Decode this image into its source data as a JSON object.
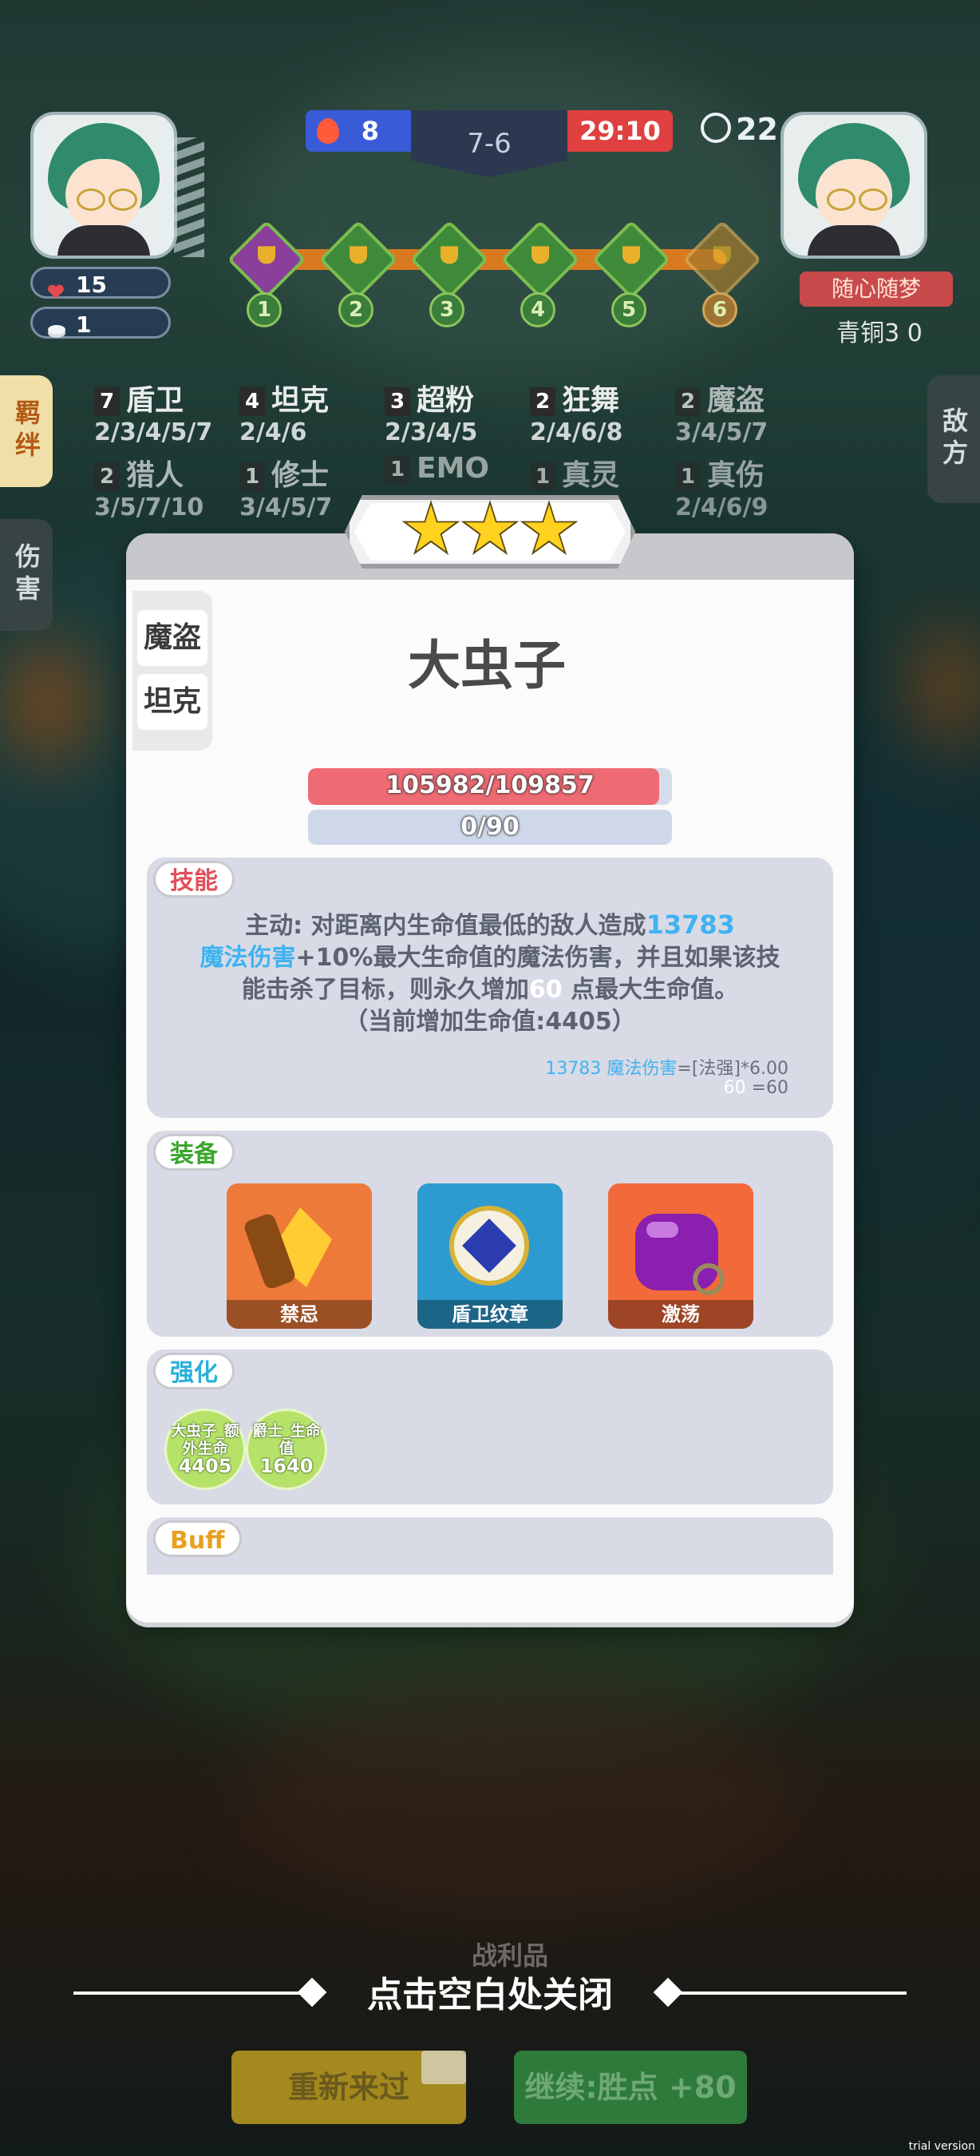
{
  "hud": {
    "hearts": "15",
    "coins": "1",
    "score_blue": "8",
    "round": "7-6",
    "score_red": "29:10",
    "timer": "22.5",
    "progress_nodes": [
      "1",
      "2",
      "3",
      "4",
      "5",
      "6"
    ],
    "opponent_badge": "随心随梦",
    "opponent_rank": "青铜3 0"
  },
  "side_tabs": {
    "left_active": "羁绊",
    "left_idle": "伤害",
    "right": "敌方"
  },
  "traits": [
    {
      "count": "7",
      "name": "盾卫",
      "levels": "2/3/4/5/7"
    },
    {
      "count": "4",
      "name": "坦克",
      "levels": "2/4/6"
    },
    {
      "count": "3",
      "name": "超粉",
      "levels": "2/3/4/5"
    },
    {
      "count": "2",
      "name": "狂舞",
      "levels": "2/4/6/8"
    },
    {
      "count": "2",
      "name": "魔盗",
      "levels": "3/4/5/7"
    },
    {
      "count": "2",
      "name": "猎人",
      "levels": "3/5/7/10"
    },
    {
      "count": "1",
      "name": "修士",
      "levels": "3/4/5/7"
    },
    {
      "count": "1",
      "name": "EMO",
      "levels": ""
    },
    {
      "count": "1",
      "name": "真灵",
      "levels": ""
    },
    {
      "count": "1",
      "name": "真伤",
      "levels": "2/4/6/9"
    }
  ],
  "modal": {
    "stars": 3,
    "tags": [
      "魔盗",
      "坦克"
    ],
    "hero_name": "大虫子",
    "hp_text": "105982/109857",
    "hp_fraction": 0.9647,
    "mp_text": "0/90",
    "skill": {
      "label": "技能",
      "line1_a": "主动: 对距离内生命值最低的敌人造成",
      "line1_b": "13783",
      "line2_a": "魔法伤害",
      "line2_b": "+10%最大生命值的魔法伤害，并且如果该技",
      "line3_a": "能击杀了目标，则永久增加",
      "line3_b": "60",
      "line3_c": "点最大生命值。",
      "line4": "（当前增加生命值:4405）",
      "formula1_a": "13783 魔法伤害",
      "formula1_b": "=[法强]*6.00",
      "formula2_a": "60",
      "formula2_b": " =60"
    },
    "equipment": {
      "label": "装备",
      "items": [
        "禁忌",
        "盾卫纹章",
        "激荡"
      ]
    },
    "enhance": {
      "label": "强化",
      "items": [
        {
          "name": "大虫子_额外生命",
          "value": "4405"
        },
        {
          "name": "爵士_生命值",
          "value": "1640"
        }
      ]
    },
    "buff": {
      "label": "Buff"
    }
  },
  "bottom": {
    "close_hint": "点击空白处关闭",
    "faded_label": "战利品",
    "retry": "重新来过",
    "continue": "继续:胜点 +80",
    "watermark": "trial version"
  },
  "colors": {
    "hp": "#ef6b73",
    "accent_blue": "#3fb3f0",
    "skill_label": "#e0505a",
    "equip_label": "#3aa52e",
    "enhance_label": "#2ab0d8",
    "buff_label": "#e8a020"
  }
}
